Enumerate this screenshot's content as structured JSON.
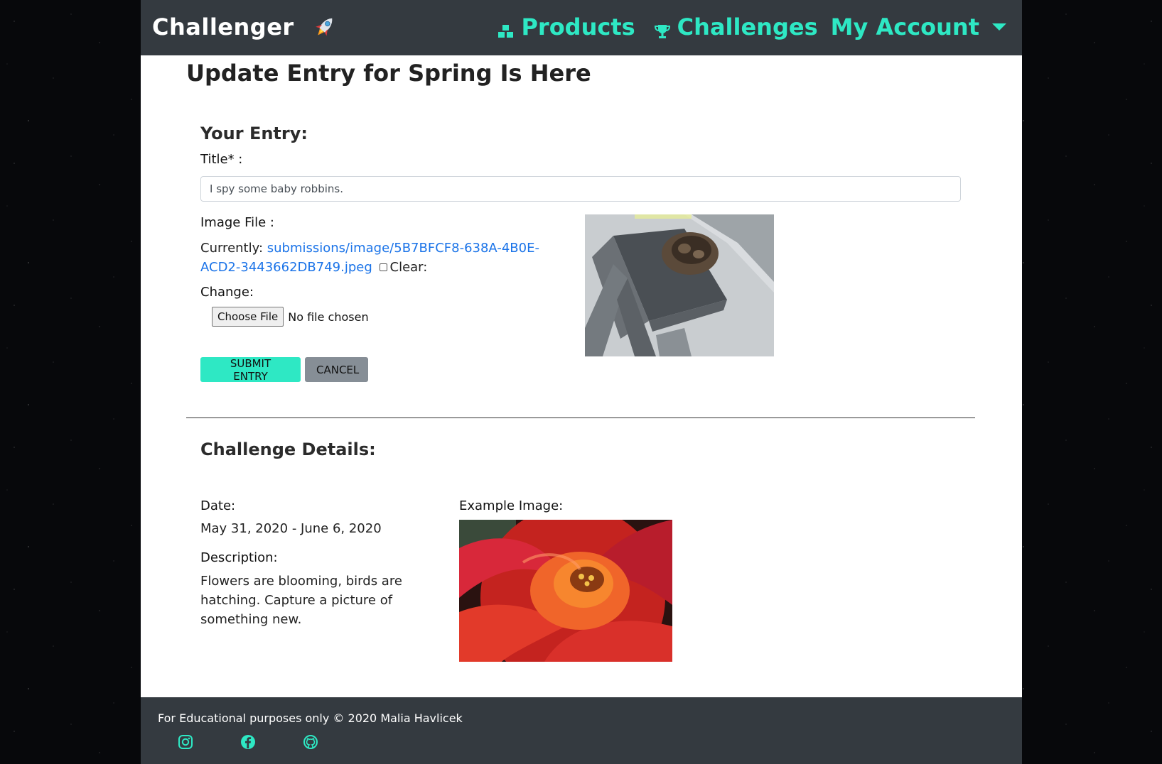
{
  "navbar": {
    "brand": "Challenger",
    "brand_icon": "rocket-icon",
    "products_label": "Products",
    "challenges_label": "Challenges",
    "account_label": "My Account",
    "accent_color": "#2ee8c4"
  },
  "page": {
    "title": "Update Entry for Spring Is Here"
  },
  "entry": {
    "heading": "Your Entry:",
    "title_label": "Title* :",
    "title_value": "I spy some baby robbins.",
    "image_label": "Image File :",
    "currently_label": "Currently:",
    "current_file": "submissions/image/5B7BFCF8-638A-4B0E-ACD2-3443662DB749.jpeg",
    "clear_label": "Clear:",
    "change_label": "Change:",
    "choose_file": "Choose File",
    "no_file": "No file chosen",
    "submit": "SUBMIT ENTRY",
    "cancel": "CANCEL"
  },
  "challenge": {
    "heading": "Challenge Details:",
    "date_label": "Date:",
    "date_value": "May 31, 2020 - June 6, 2020",
    "description_label": "Description:",
    "description_value": "Flowers are blooming, birds are hatching. Capture a picture of something new.",
    "example_label": "Example Image:"
  },
  "footer": {
    "text": "For Educational purposes only © 2020 Malia Havlicek",
    "icons": [
      "instagram-icon",
      "facebook-icon",
      "github-icon"
    ]
  }
}
